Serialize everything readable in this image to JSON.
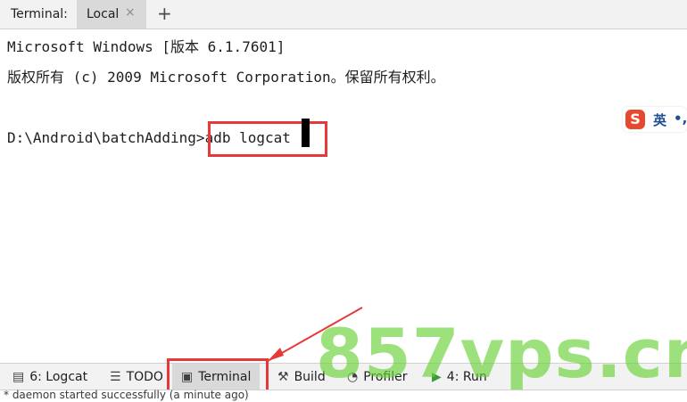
{
  "tabbar": {
    "prefix_label": "Terminal:",
    "active_tab": "Local",
    "close_glyph": "×",
    "new_glyph": "+"
  },
  "terminal": {
    "line1": "Microsoft Windows [版本 6.1.7601]",
    "line2": "版权所有 (c) 2009 Microsoft Corporation。保留所有权利。",
    "prompt": "D:\\Android\\batchAdding>",
    "command": "adb logcat"
  },
  "ime": {
    "logo_letter": "S",
    "mode": "英",
    "punct": "•,"
  },
  "toolbar": {
    "logcat": {
      "label": "6: Logcat",
      "icon": "logcat-icon"
    },
    "todo": {
      "label": "TODO",
      "icon": "list-icon"
    },
    "terminal": {
      "label": "Terminal",
      "icon": "terminal-icon"
    },
    "build": {
      "label": "Build",
      "icon": "hammer-icon"
    },
    "profiler": {
      "label": "Profiler",
      "icon": "gauge-icon"
    },
    "run": {
      "label": "4: Run",
      "icon": "run-icon"
    }
  },
  "status": {
    "message": "* daemon started successfully (a minute ago)"
  },
  "watermark": {
    "text": "857vps.cn"
  },
  "colors": {
    "highlight": "#e63a3a",
    "watermark": "#68d137",
    "bar_bg": "#f2f2f2",
    "active_tab_bg": "#d9d9d9"
  }
}
